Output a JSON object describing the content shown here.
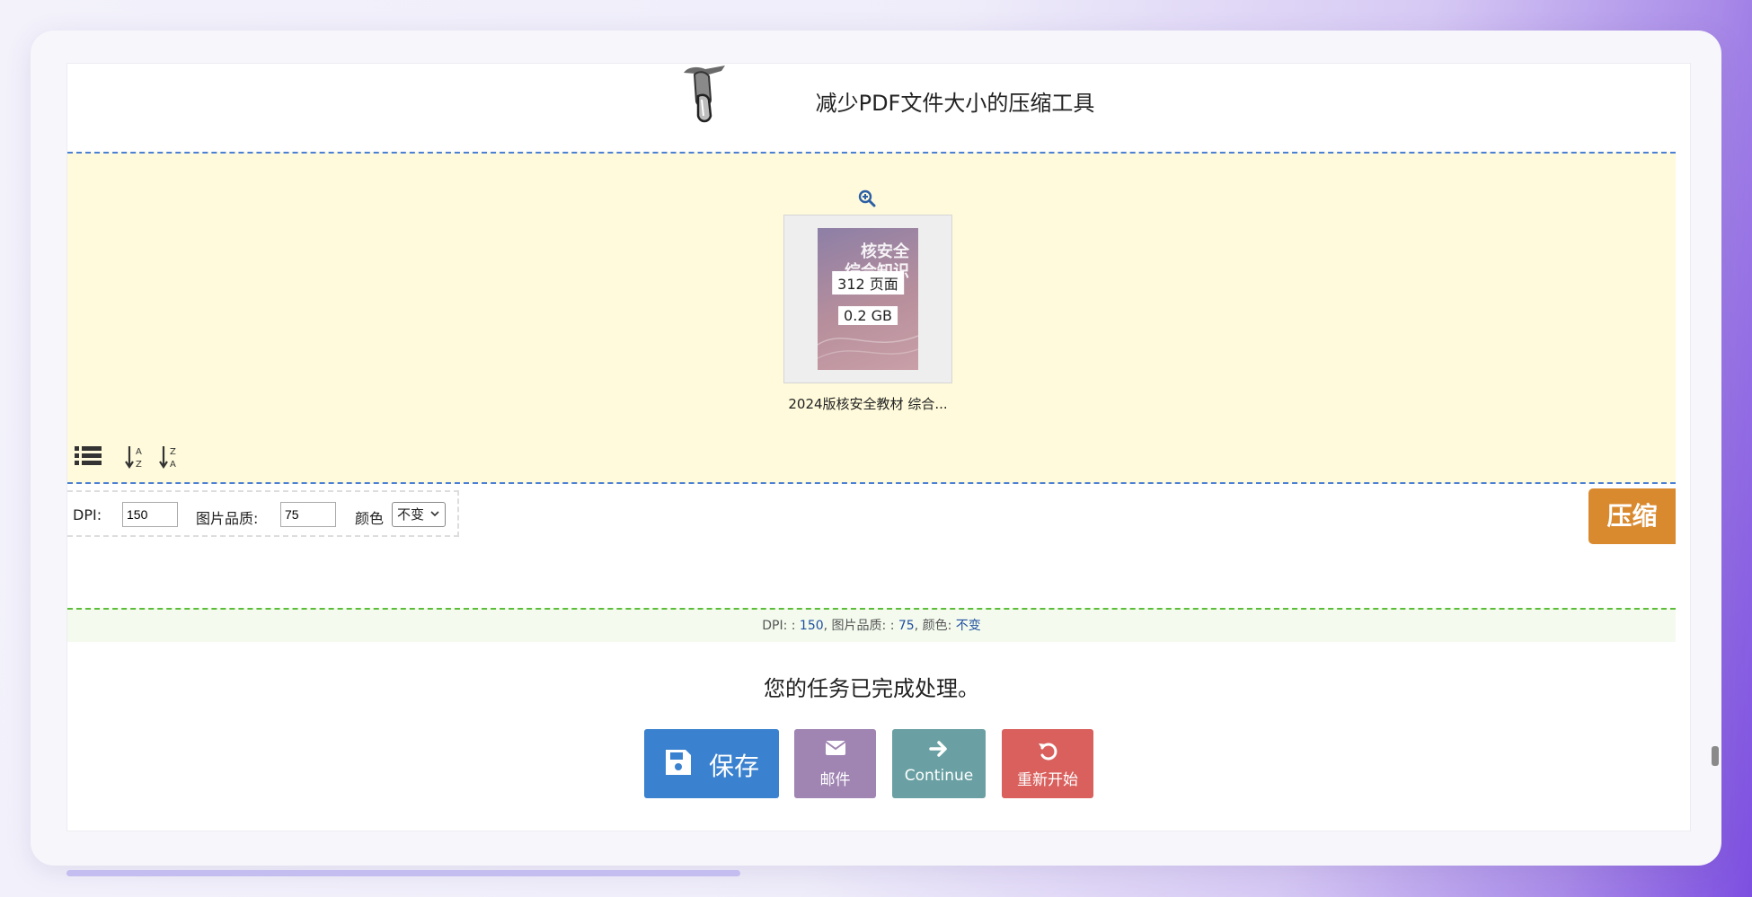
{
  "header": {
    "title": "减少PDF文件大小的压缩工具"
  },
  "file": {
    "cover_text": "核安全\n综合知识",
    "pages": "312 页面",
    "size": "0.2 GB",
    "name": "2024版核安全教材 综合..."
  },
  "icons": {
    "zoom": "zoom-in-icon",
    "list": "list-icon",
    "sort_az": "sort-alpha-asc-icon",
    "sort_za": "sort-alpha-desc-icon",
    "save": "floppy-disk-icon",
    "mail": "envelope-icon",
    "continue": "arrow-right-icon",
    "restart": "undo-icon"
  },
  "options": {
    "dpi_label": "DPI:",
    "dpi_value": "150",
    "quality_label": "图片品质:",
    "quality_value": "75",
    "color_label": "颜色",
    "color_value": "不变"
  },
  "compress_label": "压缩",
  "settings_summary": {
    "dpi_prefix": "DPI: : ",
    "dpi": "150",
    "quality_prefix": ", 图片品质: : ",
    "quality": "75",
    "color_prefix": ", 颜色: ",
    "color": "不变"
  },
  "done_message": "您的任务已完成处理。",
  "actions": {
    "save": "保存",
    "mail": "邮件",
    "continue": "Continue",
    "restart": "重新开始"
  },
  "colors": {
    "dropzone_bg": "#fefadb",
    "compress": "#d9892e",
    "save": "#3a81cf",
    "mail": "#a085b3",
    "continue": "#6aa0a3",
    "restart": "#d9605d"
  }
}
